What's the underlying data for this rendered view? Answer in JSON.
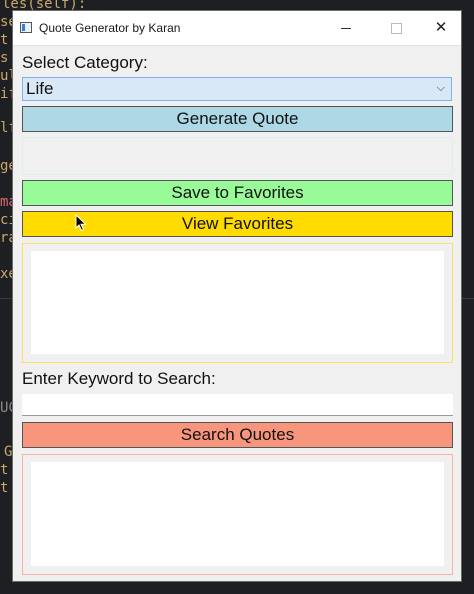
{
  "background": {
    "code_fragments": [
      "les(self):",
      "se",
      "t",
      "s",
      "ul",
      "if",
      "lf",
      "ge",
      "ma",
      "ci",
      "ra",
      "xe",
      "UC",
      "G",
      "t",
      "t"
    ]
  },
  "window": {
    "title": "Quote Generator by Karan",
    "controls": {
      "minimize": "─",
      "maximize": "☐",
      "close": "✕"
    }
  },
  "category": {
    "label": "Select Category:",
    "selected": "Life",
    "chevron": "⌵"
  },
  "buttons": {
    "generate": "Generate Quote",
    "save": "Save to Favorites",
    "view": "View Favorites",
    "search": "Search Quotes"
  },
  "quote_display": {
    "text": ""
  },
  "search": {
    "label": "Enter Keyword to Search:",
    "value": "",
    "placeholder": ""
  },
  "colors": {
    "generate": "#add8e6",
    "save": "#98fb98",
    "view": "#ffdb00",
    "search": "#f8957d"
  }
}
